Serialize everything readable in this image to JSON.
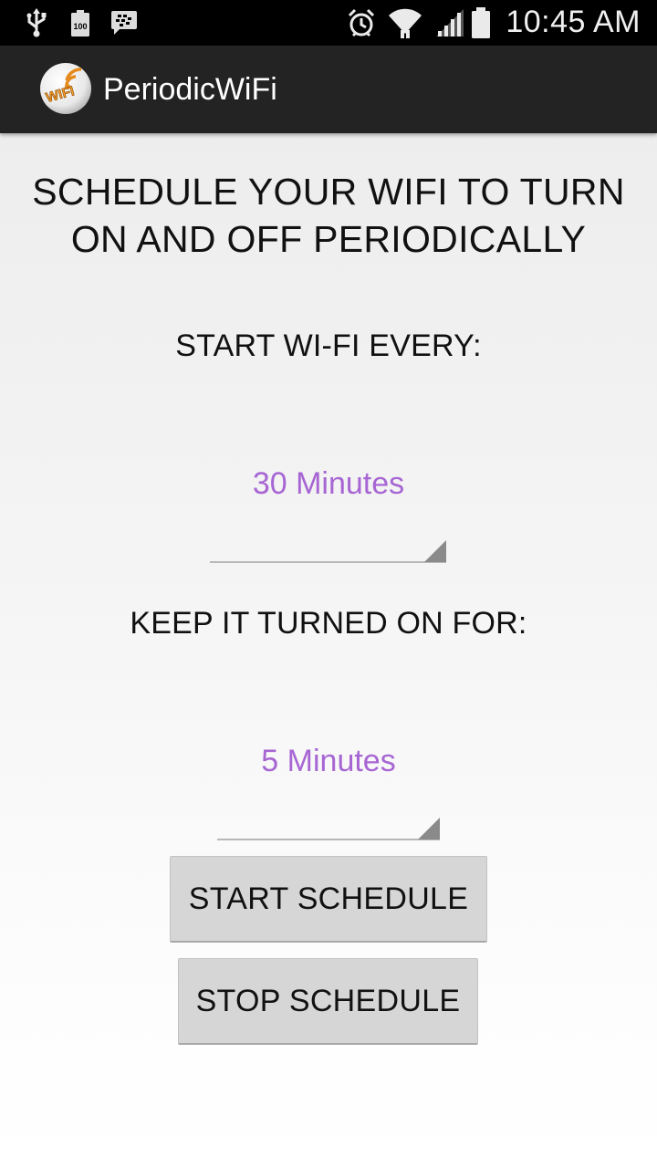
{
  "status_bar": {
    "time": "10:45 AM",
    "battery_small": "100",
    "icons": [
      "usb-icon",
      "battery-100-icon",
      "bbm-icon",
      "alarm-icon",
      "wifi-icon",
      "signal-icon",
      "battery-icon"
    ]
  },
  "action_bar": {
    "title": "PeriodicWiFi",
    "logo_text": "WIFI"
  },
  "main": {
    "headline_line1": "SCHEDULE YOUR WIFI TO TURN",
    "headline_line2": "ON AND OFF PERIODICALLY",
    "start_label": "START WI-FI EVERY:",
    "start_value": "30 Minutes",
    "keep_label": "KEEP IT TURNED ON FOR:",
    "keep_value": "5 Minutes"
  },
  "buttons": {
    "start": "START SCHEDULE",
    "stop": "STOP SCHEDULE"
  },
  "colors": {
    "accent": "#a766d3",
    "action_bar": "#232323",
    "button": "#d6d6d6"
  }
}
